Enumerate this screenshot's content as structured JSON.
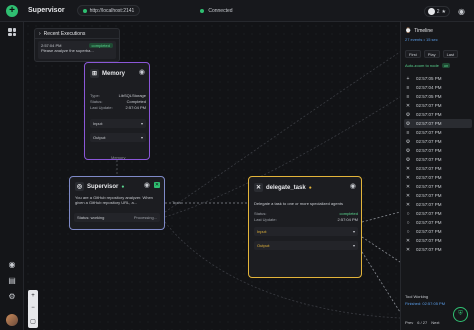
{
  "app": {
    "name": "Supervisor",
    "url": "http://localhost:2141",
    "connection": "Connected",
    "github_stars": "2"
  },
  "recent": {
    "title": "Recent Executions",
    "time": "2:57:04 PM",
    "status": "completed",
    "text": "Please analyze the superba..."
  },
  "memory": {
    "title": "Memory",
    "rows": [
      {
        "k": "Type:",
        "v": "LibSQLStorage"
      },
      {
        "k": "Status:",
        "v": "Completed"
      },
      {
        "k": "Last Update:",
        "v": "2:57:04 PM"
      }
    ],
    "input_label": "Input:",
    "output_label": "Output:"
  },
  "supervisor": {
    "title": "Supervisor",
    "desc": "You are a GitHub repository analyzer. When given a GitHub repository URL, a...",
    "status": "Status: working",
    "processing": "Processing..."
  },
  "delegate": {
    "title": "delegate_task",
    "desc": "Delegate a task to one or more specialized agents",
    "rows": [
      {
        "k": "Status:",
        "v": "completed"
      },
      {
        "k": "Last Update:",
        "v": "2:57:04 PM"
      }
    ],
    "input_label": "Input:",
    "output_label": "Output:"
  },
  "edges": {
    "memory_label": "Memory",
    "tool_label": "Tools"
  },
  "timeline": {
    "title": "Timeline",
    "count": "27 events • 15 sec",
    "btn_first": "First",
    "btn_play": "Play",
    "btn_last": "Last",
    "auto_label": "Auto-zoom to node",
    "auto_state": "on",
    "events": [
      {
        "icon": "+",
        "time": "02:57:05 PM"
      },
      {
        "icon": "≡",
        "time": "02:57:04 PM"
      },
      {
        "icon": "≡",
        "time": "02:57:05 PM"
      },
      {
        "icon": "✕",
        "time": "02:57:07 PM"
      },
      {
        "icon": "⚙",
        "time": "02:57:07 PM"
      },
      {
        "icon": "⚙",
        "time": "02:57:07 PM"
      },
      {
        "icon": "≡",
        "time": "02:57:07 PM"
      },
      {
        "icon": "⚙",
        "time": "02:57:07 PM"
      },
      {
        "icon": "⚙",
        "time": "02:57:07 PM"
      },
      {
        "icon": "⚙",
        "time": "02:57:07 PM"
      },
      {
        "icon": "✕",
        "time": "02:57:07 PM"
      },
      {
        "icon": "✕",
        "time": "02:57:07 PM"
      },
      {
        "icon": "✕",
        "time": "02:57:07 PM"
      },
      {
        "icon": "✕",
        "time": "02:57:07 PM"
      },
      {
        "icon": "✕",
        "time": "02:57:07 PM"
      },
      {
        "icon": "○",
        "time": "02:57:07 PM"
      },
      {
        "icon": "○",
        "time": "02:57:07 PM"
      },
      {
        "icon": "○",
        "time": "02:57:07 PM"
      },
      {
        "icon": "✕",
        "time": "02:57:07 PM"
      },
      {
        "icon": "✕",
        "time": "02:57:07 PM"
      }
    ],
    "tool_title": "Tool Working",
    "tool_finished": "Finished: 02:57:05 PM",
    "pager_prev": "Prev",
    "pager_pos": "6 / 27",
    "pager_next": "Next"
  },
  "colors": {
    "accent": "#2fbf71",
    "memory": "#8b57d8",
    "supervisor": "#7f8ac8",
    "delegate": "#e3b43a"
  }
}
